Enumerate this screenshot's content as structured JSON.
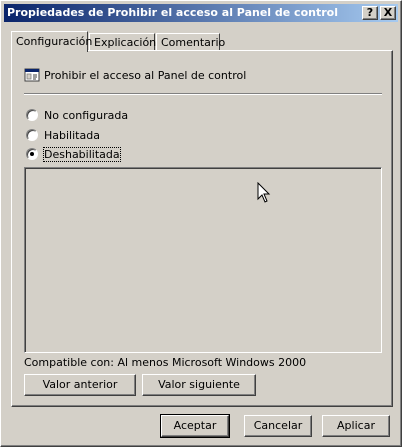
{
  "window": {
    "title": "Propiedades de Prohibir el acceso al Panel de control",
    "help_button": "?",
    "close_button": "X"
  },
  "tabs": [
    {
      "label": "Configuración",
      "active": true
    },
    {
      "label": "Explicación",
      "active": false
    },
    {
      "label": "Comentario",
      "active": false
    }
  ],
  "policy": {
    "name": "Prohibir el acceso al Panel de control",
    "icon": "policy-setting-icon"
  },
  "options": [
    {
      "label": "No configurada",
      "checked": false
    },
    {
      "label": "Habilitada",
      "checked": false
    },
    {
      "label": "Deshabilitada",
      "checked": true
    }
  ],
  "compatibility": "Compatible con: Al menos Microsoft Windows 2000",
  "nav_buttons": {
    "previous": "Valor anterior",
    "next": "Valor siguiente"
  },
  "dialog_buttons": {
    "ok": "Aceptar",
    "cancel": "Cancelar",
    "apply": "Aplicar"
  }
}
